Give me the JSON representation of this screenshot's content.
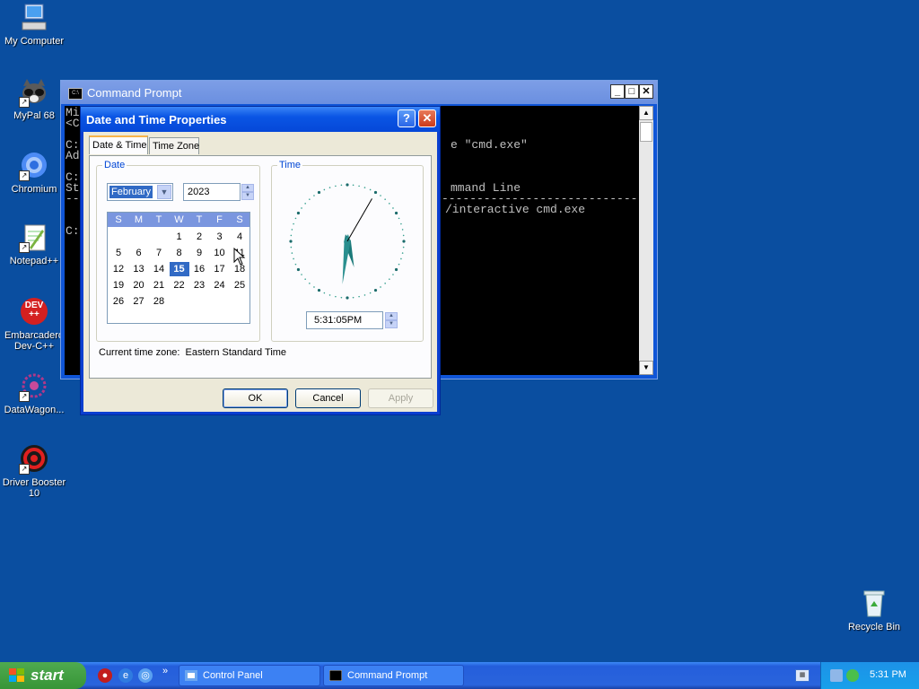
{
  "desktop": {
    "icons": [
      {
        "label": "My Computer"
      },
      {
        "label": "MyPal 68"
      },
      {
        "label": "Chromium"
      },
      {
        "label": "Notepad++"
      },
      {
        "label": "Embarcadero Dev-C++",
        "label_line1": "Embarcadero",
        "label_line2": "Dev-C++",
        "badge": "DEV ++"
      },
      {
        "label": "DataWagon..."
      },
      {
        "label": "Driver Booster 10",
        "label_line1": "Driver Booster",
        "label_line2": "10"
      },
      {
        "label": "Recycle Bin"
      }
    ]
  },
  "cmd": {
    "title": "Command Prompt",
    "icon_text": "C:\\",
    "lines": [
      "Mi",
      "<C",
      "C:                                                e \"cmd.exe\"",
      "Ad",
      "C:",
      "St                                               mmand Line",
      "--                                              ----------------------------",
      "                                                /interactive cmd.exe",
      "C:"
    ],
    "line_visible_left": [
      "Mi",
      "<C",
      "C:",
      "Ad",
      "C:",
      "St",
      "--",
      "",
      "C:"
    ],
    "line_visible_right": [
      "",
      "",
      "e \"cmd.exe\"",
      "",
      "",
      "mmand Line",
      "----------------------------",
      "/interactive cmd.exe",
      ""
    ]
  },
  "dialog": {
    "title": "Date and Time Properties",
    "help_label": "?",
    "close_label": "✕",
    "tabs": [
      {
        "label": "Date & Time",
        "active": true
      },
      {
        "label": "Time Zone",
        "active": false
      }
    ],
    "date_group_label": "Date",
    "month": "February",
    "year": "2023",
    "weekdays": [
      "S",
      "M",
      "T",
      "W",
      "T",
      "F",
      "S"
    ],
    "days": [
      "1",
      "2",
      "3",
      "4",
      "5",
      "6",
      "7",
      "8",
      "9",
      "10",
      "11",
      "12",
      "13",
      "14",
      "15",
      "16",
      "17",
      "18",
      "19",
      "20",
      "21",
      "22",
      "23",
      "24",
      "25",
      "26",
      "27",
      "28"
    ],
    "first_weekday_index": 3,
    "selected_day": "15",
    "time_group_label": "Time",
    "time_value": "5:31:05PM",
    "clock": {
      "hour": 5,
      "minute": 31,
      "second": 5
    },
    "timezone_prefix": "Current time zone:",
    "timezone_value": "Eastern Standard Time",
    "ok_label": "OK",
    "cancel_label": "Cancel",
    "apply_label": "Apply"
  },
  "taskbar": {
    "start_label": "start",
    "tasks": [
      {
        "label": "Control Panel"
      },
      {
        "label": "Command Prompt"
      }
    ],
    "clock": "5:31 PM"
  },
  "colors": {
    "desktop": "#0a4ea0",
    "title_active": "#0a55e4",
    "selection": "#316ac5"
  }
}
